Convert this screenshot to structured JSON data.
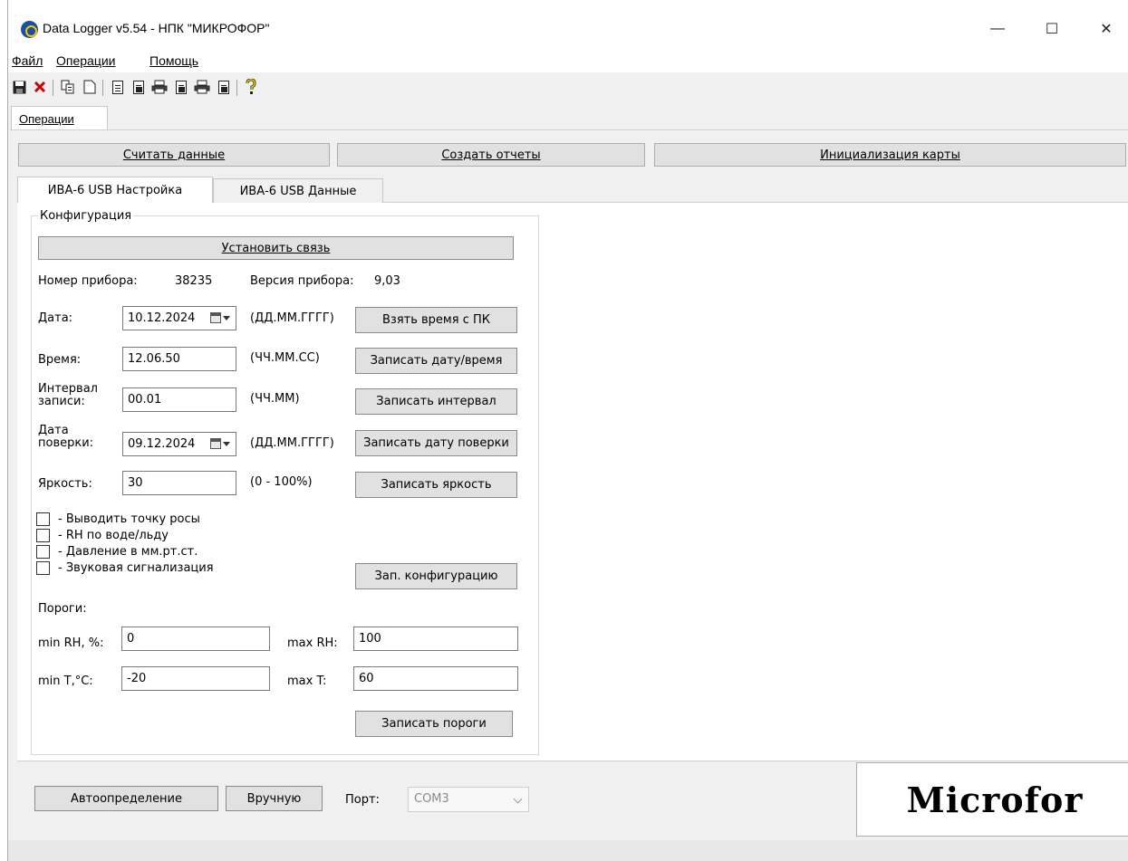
{
  "window": {
    "title": "Data Logger v5.54  -  НПК \"МИКРОФОР\"",
    "minimize": "—",
    "maximize": "☐",
    "close": "✕"
  },
  "menu": {
    "file": "Файл",
    "operations": "Операции",
    "help": "Помощь"
  },
  "toolbar": {
    "icons": [
      "save-icon",
      "delete-icon",
      "copy-icon",
      "new-doc-icon",
      "report-icon",
      "report-dark-icon",
      "print-icon",
      "report2-icon",
      "print2-icon",
      "report3-icon",
      "help-icon"
    ]
  },
  "outer_tab": {
    "label": "Операции"
  },
  "top_buttons": {
    "read_data": "Считать данные",
    "create_reports": "Создать отчеты",
    "init_card": "Инициализация карты"
  },
  "inner_tabs": {
    "settings": "ИВА-6 USB Настройка",
    "data": "ИВА-6 USB Данные"
  },
  "config": {
    "group_title": "Конфигурация",
    "connect_button": "Установить связь",
    "device_number_label": "Номер прибора:",
    "device_number": "38235",
    "device_version_label": "Версия прибора:",
    "device_version": "9,03",
    "date_label": "Дата:",
    "date_value": "10.12.2024",
    "date_format": "(ДД.ММ.ГГГГ)",
    "take_time_button": "Взять время с ПК",
    "time_label": "Время:",
    "time_value": "12.06.50",
    "time_format": "(ЧЧ.ММ.СС)",
    "write_datetime_button": "Записать дату/время",
    "interval_label_1": "Интервал",
    "interval_label_2": "записи:",
    "interval_value": "00.01",
    "interval_format": "(ЧЧ.ММ)",
    "write_interval_button": "Записать интервал",
    "verify_label_1": "Дата",
    "verify_label_2": "поверки:",
    "verify_value": "09.12.2024",
    "verify_format": "(ДД.ММ.ГГГГ)",
    "write_verify_button": "Записать дату поверки",
    "brightness_label": "Яркость:",
    "brightness_value": "30",
    "brightness_format": "(0 - 100%)",
    "write_brightness_button": "Записать яркость",
    "checkboxes": [
      {
        "label": "-  Выводить точку росы",
        "checked": false
      },
      {
        "label": "-  RH по воде/льду",
        "checked": false
      },
      {
        "label": "-  Давление в мм.рт.ст.",
        "checked": false
      },
      {
        "label": "-  Звуковая сигнализация",
        "checked": false
      }
    ],
    "write_config_button": "Зап. конфигурацию",
    "thresholds_label": "Пороги:",
    "min_rh_label": "min RH, %:",
    "min_rh_value": "0",
    "max_rh_label": "max RH:",
    "max_rh_value": "100",
    "min_t_label": "min T,°C:",
    "min_t_value": "-20",
    "max_t_label": "max T:",
    "max_t_value": "60",
    "write_thresholds_button": "Записать пороги"
  },
  "bottom": {
    "auto_button": "Автоопределение",
    "manual_button": "Вручную",
    "port_label": "Порт:",
    "port_value": "COM3",
    "logo": "Microfor"
  }
}
